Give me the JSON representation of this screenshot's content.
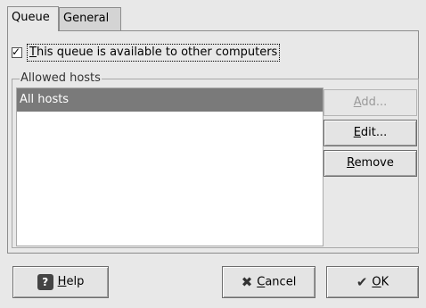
{
  "tabs": [
    {
      "label": "Queue"
    },
    {
      "label": "General"
    }
  ],
  "share_checkbox": {
    "checked": true,
    "mnemonic": "T",
    "label_rest": "his queue is available to other computers"
  },
  "allowed_hosts": {
    "frame_label": "Allowed hosts",
    "items": [
      "All hosts"
    ]
  },
  "side_buttons": {
    "add": {
      "mnemonic": "A",
      "rest": "dd..."
    },
    "edit": {
      "mnemonic": "E",
      "rest": "dit..."
    },
    "remove": {
      "mnemonic": "R",
      "rest": "emove"
    }
  },
  "bottom_buttons": {
    "help": {
      "mnemonic": "H",
      "rest": "elp",
      "icon": "help-icon"
    },
    "cancel": {
      "mnemonic": "C",
      "rest": "ancel",
      "icon": "cancel-x-icon"
    },
    "ok": {
      "mnemonic": "O",
      "rest": "K",
      "icon": "ok-check-icon"
    }
  }
}
